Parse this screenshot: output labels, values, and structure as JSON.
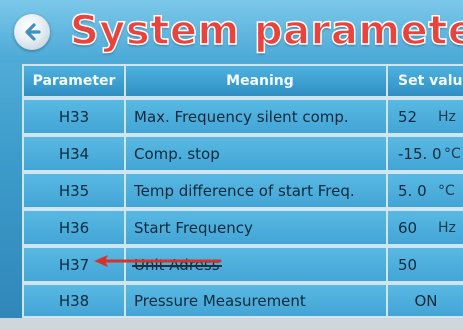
{
  "header": {
    "title": "System parameters",
    "back_icon": "back-arrow-icon"
  },
  "table": {
    "columns": [
      "Parameter",
      "Meaning",
      "Set value"
    ],
    "rows": [
      {
        "param": "H33",
        "meaning": "Max. Frequency silent comp.",
        "value": "52",
        "unit": "Hz"
      },
      {
        "param": "H34",
        "meaning": "Comp. stop",
        "value": "-15. 0",
        "unit": "°C"
      },
      {
        "param": "H35",
        "meaning": "Temp difference of start Freq.",
        "value": "5. 0",
        "unit": "°C"
      },
      {
        "param": "H36",
        "meaning": "Start Frequency",
        "value": "60",
        "unit": "Hz"
      },
      {
        "param": "H37",
        "meaning": "Unit Adress",
        "value": "50",
        "unit": ""
      },
      {
        "param": "H38",
        "meaning": "Pressure Measurement",
        "value": "ON",
        "unit": ""
      }
    ]
  },
  "annotation": {
    "arrow_color": "#d9302a",
    "icon": "red-arrow-icon"
  }
}
